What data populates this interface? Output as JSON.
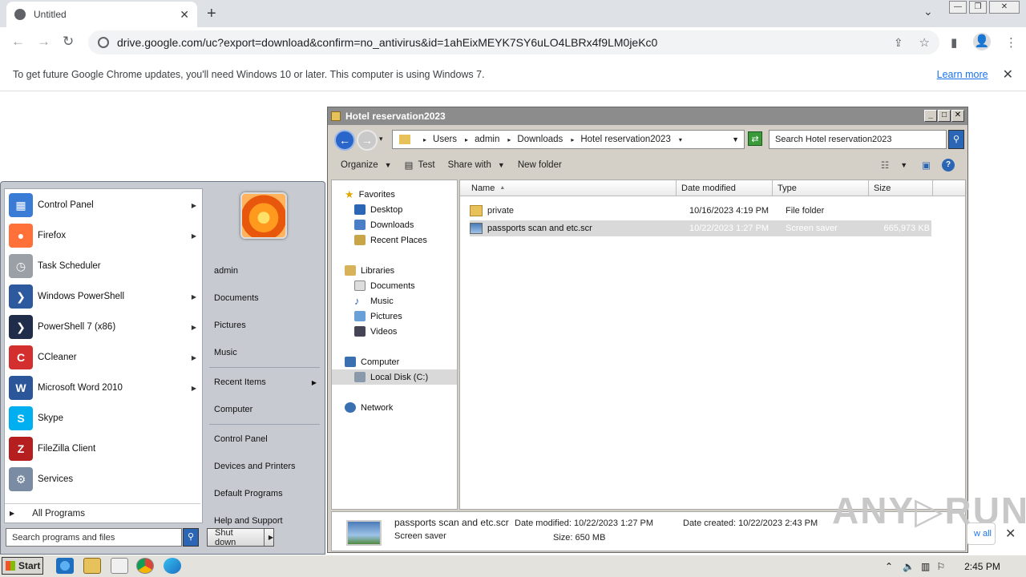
{
  "browser": {
    "tab_title": "Untitled",
    "url": "drive.google.com/uc?export=download&confirm=no_antivirus&id=1ahEixMEYK7SY6uLO4LBRx4f9LM0jeKc0",
    "info_message": "To get future Google Chrome updates, you'll need Windows 10 or later. This computer is using Windows 7.",
    "learn_more": "Learn more",
    "download_view_all": "w all"
  },
  "start_menu": {
    "programs": [
      {
        "label": "Control Panel",
        "icon": "control-panel-icon",
        "color": "#3a7bd5",
        "glyph": "▦",
        "arrow": true
      },
      {
        "label": "Firefox",
        "icon": "firefox-icon",
        "color": "#ff7139",
        "glyph": "●",
        "arrow": true
      },
      {
        "label": "Task Scheduler",
        "icon": "clock-icon",
        "color": "#9aa0a6",
        "glyph": "◷",
        "arrow": false
      },
      {
        "label": "Windows PowerShell",
        "icon": "powershell-icon",
        "color": "#2d5a9e",
        "glyph": "❯",
        "arrow": true
      },
      {
        "label": "PowerShell 7 (x86)",
        "icon": "powershell7-icon",
        "color": "#1f2d4a",
        "glyph": "❯",
        "arrow": true
      },
      {
        "label": "CCleaner",
        "icon": "ccleaner-icon",
        "color": "#d32f2f",
        "glyph": "C",
        "arrow": true
      },
      {
        "label": "Microsoft Word 2010",
        "icon": "word-icon",
        "color": "#2b579a",
        "glyph": "W",
        "arrow": true
      },
      {
        "label": "Skype",
        "icon": "skype-icon",
        "color": "#00aff0",
        "glyph": "S",
        "arrow": false
      },
      {
        "label": "FileZilla Client",
        "icon": "filezilla-icon",
        "color": "#b51f1f",
        "glyph": "Z",
        "arrow": false
      },
      {
        "label": "Services",
        "icon": "gear-icon",
        "color": "#7a8ca3",
        "glyph": "⚙",
        "arrow": false
      }
    ],
    "all_programs": "All Programs",
    "right_items": [
      "admin",
      "Documents",
      "Pictures",
      "Music",
      "Recent Items",
      "Computer",
      "Control Panel",
      "Devices and Printers",
      "Default Programs",
      "Help and Support"
    ],
    "search_placeholder": "Search programs and files",
    "shutdown": "Shut down"
  },
  "explorer": {
    "title": "Hotel reservation2023",
    "breadcrumbs": [
      "Users",
      "admin",
      "Downloads",
      "Hotel reservation2023"
    ],
    "search_placeholder": "Search Hotel reservation2023",
    "commands": {
      "organize": "Organize",
      "test": "Test",
      "share_with": "Share with",
      "new_folder": "New folder"
    },
    "nav": {
      "favorites": "Favorites",
      "favorites_items": [
        "Desktop",
        "Downloads",
        "Recent Places"
      ],
      "libraries": "Libraries",
      "libraries_items": [
        "Documents",
        "Music",
        "Pictures",
        "Videos"
      ],
      "computer": "Computer",
      "computer_items": [
        "Local Disk (C:)"
      ],
      "network": "Network"
    },
    "columns": {
      "name": "Name",
      "date": "Date modified",
      "type": "Type",
      "size": "Size"
    },
    "files": [
      {
        "name": "private",
        "date": "10/16/2023 4:19 PM",
        "type": "File folder",
        "size": ""
      },
      {
        "name": "passports scan and etc.scr",
        "date": "10/22/2023 1:27 PM",
        "type": "Screen saver",
        "size": "665,973 KB"
      }
    ],
    "details": {
      "name": "passports scan and etc.scr",
      "type": "Screen saver",
      "date_modified": "Date modified:  10/22/2023 1:27 PM",
      "date_created": "Date created:  10/22/2023 2:43 PM",
      "size": "Size:  650 MB"
    }
  },
  "watermark": "ANY▷RUN",
  "taskbar": {
    "start": "Start",
    "time": "2:45 PM"
  }
}
